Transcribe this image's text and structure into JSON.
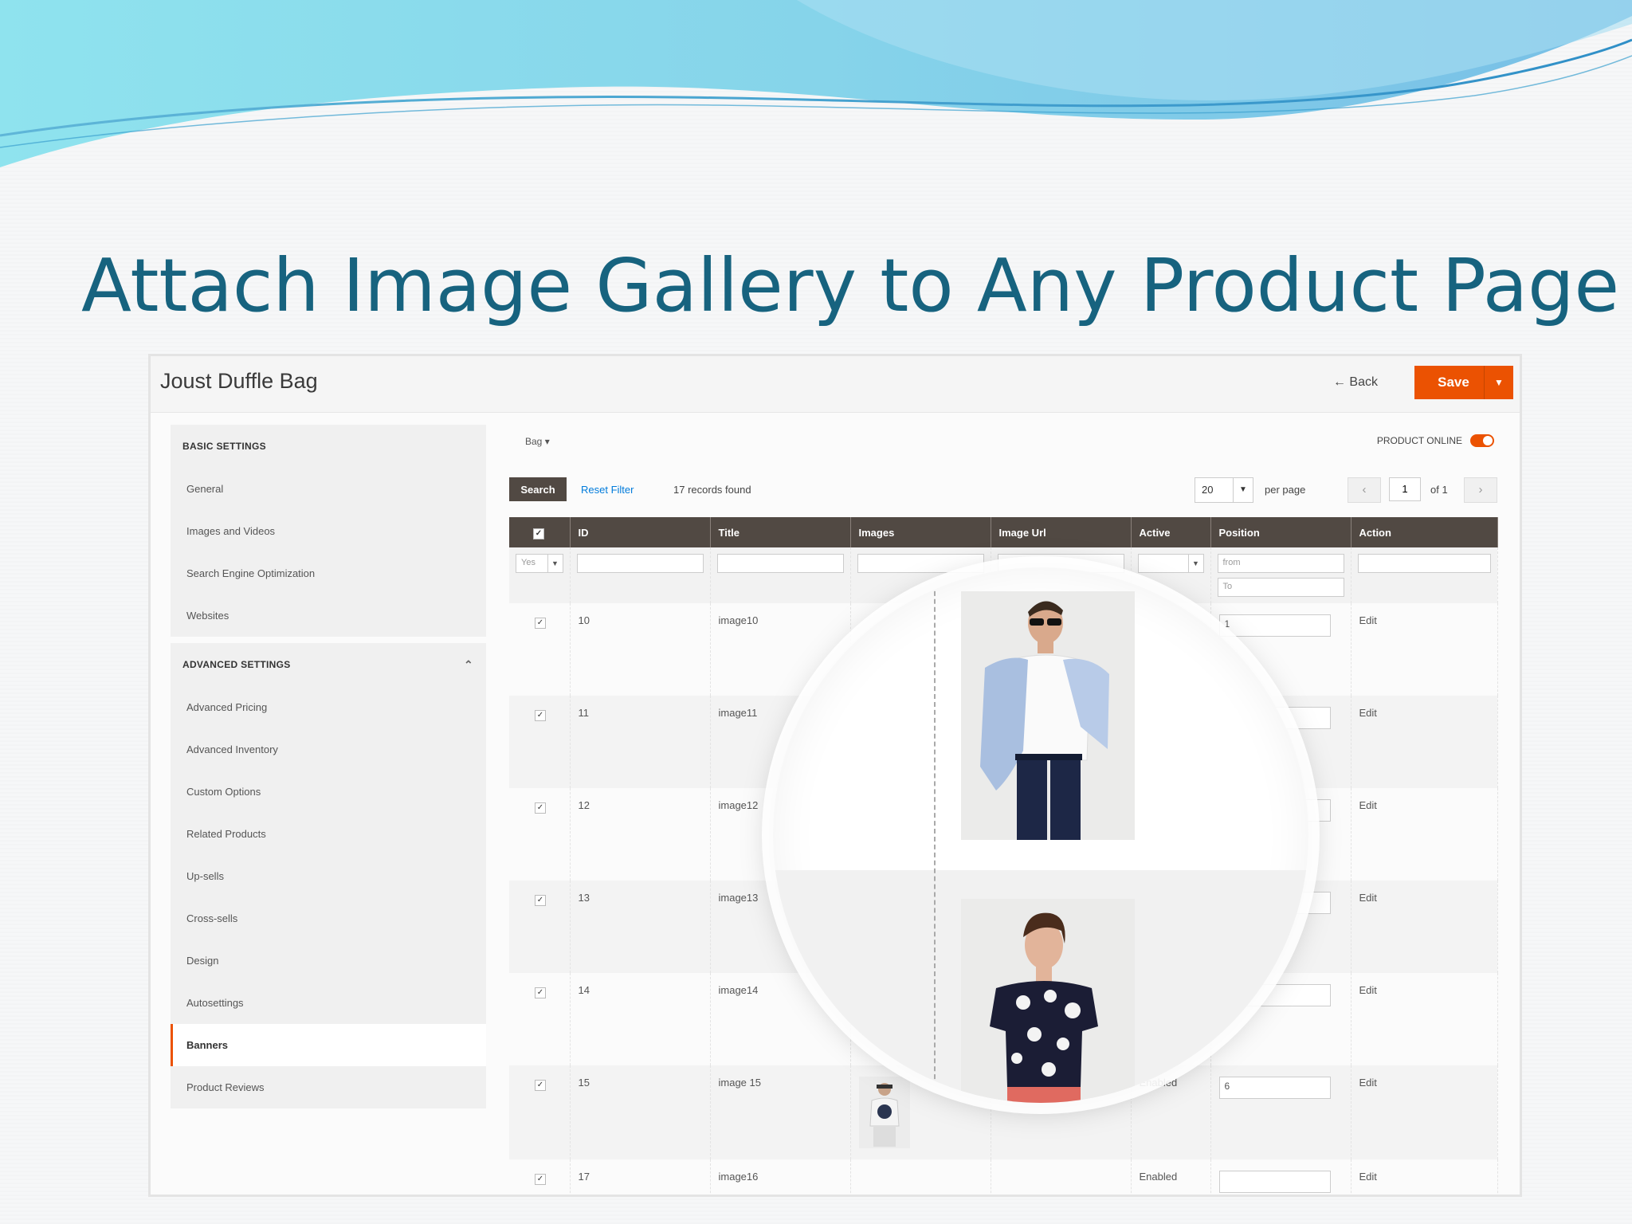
{
  "slide": {
    "title": "Attach Image Gallery to Any Product Page"
  },
  "product": {
    "title": "Joust Duffle Bag",
    "back_label": "Back",
    "save_label": "Save"
  },
  "sidebar": {
    "basic_header": "BASIC SETTINGS",
    "basic_items": [
      "General",
      "Images and Videos",
      "Search Engine Optimization",
      "Websites"
    ],
    "advanced_header": "ADVANCED SETTINGS",
    "advanced_items": [
      "Advanced Pricing",
      "Advanced Inventory",
      "Custom Options",
      "Related Products",
      "Up-sells",
      "Cross-sells",
      "Design",
      "Autosettings",
      "Banners",
      "Product Reviews"
    ],
    "active_item": "Banners"
  },
  "main": {
    "store_switcher": "Bag",
    "product_online_label": "PRODUCT ONLINE",
    "search_label": "Search",
    "reset_filter_label": "Reset Filter",
    "records_found": "17 records found",
    "per_page_value": "20",
    "per_page_label": "per page",
    "page_value": "1",
    "of_pages": "of 1"
  },
  "grid": {
    "columns": [
      "",
      "ID",
      "Title",
      "Images",
      "Image Url",
      "Active",
      "Position",
      "Action"
    ],
    "filters": {
      "select_value": "Yes",
      "position_from": "from",
      "position_to": "To"
    },
    "rows": [
      {
        "id": "10",
        "title": "image10",
        "active": "",
        "position": "1",
        "action": "Edit"
      },
      {
        "id": "11",
        "title": "image11",
        "active": "",
        "position": "",
        "action": "Edit"
      },
      {
        "id": "12",
        "title": "image12",
        "active": "",
        "position": "",
        "action": "Edit"
      },
      {
        "id": "13",
        "title": "image13",
        "active": "",
        "position": "",
        "action": "Edit"
      },
      {
        "id": "14",
        "title": "image14",
        "active": "",
        "position": "",
        "action": "Edit"
      },
      {
        "id": "15",
        "title": "image 15",
        "active": "Enabled",
        "position": "6",
        "action": "Edit"
      },
      {
        "id": "17",
        "title": "image16",
        "active": "Enabled",
        "position": "",
        "action": "Edit"
      }
    ]
  },
  "colors": {
    "accent": "#eb5202",
    "grid_header": "#514943",
    "title": "#17637f"
  }
}
